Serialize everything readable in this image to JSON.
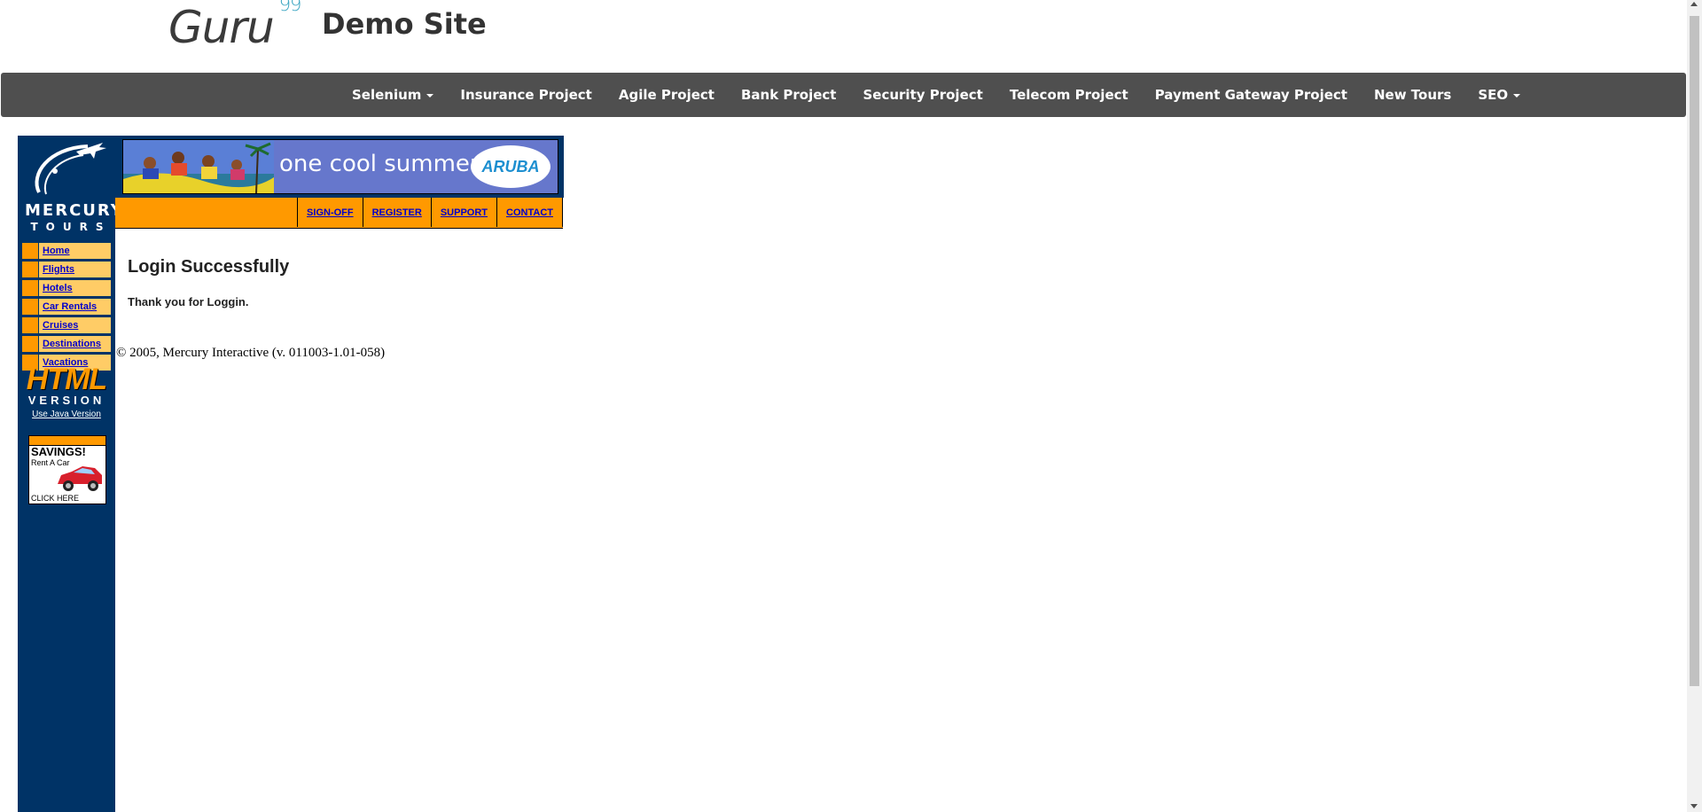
{
  "header": {
    "logo_text": "Guru",
    "logo_sup": "99",
    "site_title": "Demo Site"
  },
  "navbar": {
    "items": [
      {
        "label": "Selenium",
        "dropdown": true
      },
      {
        "label": "Insurance Project",
        "dropdown": false
      },
      {
        "label": "Agile Project",
        "dropdown": false
      },
      {
        "label": "Bank Project",
        "dropdown": false
      },
      {
        "label": "Security Project",
        "dropdown": false
      },
      {
        "label": "Telecom Project",
        "dropdown": false
      },
      {
        "label": "Payment Gateway Project",
        "dropdown": false
      },
      {
        "label": "New Tours",
        "dropdown": false
      },
      {
        "label": "SEO",
        "dropdown": true
      }
    ]
  },
  "mercury": {
    "logo_name": "MERCURY",
    "logo_sub": "TOURS",
    "side_menu": [
      "Home",
      "Flights",
      "Hotels",
      "Car Rentals",
      "Cruises",
      "Destinations",
      "Vacations"
    ],
    "html_badge": "HTML",
    "html_version": "VERSION",
    "java_link": "Use Java Version",
    "ad_title": "SAVINGS!",
    "ad_sub": "Rent A Car",
    "ad_cta": "CLICK HERE"
  },
  "banner": {
    "text": "one cool summer",
    "brand": "ARUBA"
  },
  "top_links": [
    "SIGN-OFF",
    "REGISTER",
    "SUPPORT",
    "CONTACT"
  ],
  "content": {
    "title": "Login Successfully",
    "message": "Thank you for Loggin.",
    "copyright": "© 2005, Mercury Interactive (v. 011003-1.01-058)"
  },
  "colors": {
    "navbar_bg": "#4f4f4f",
    "sidebar_bg": "#003366",
    "orange": "#ff9900",
    "menu_bg": "#ffcc66",
    "link": "#0000cc"
  }
}
